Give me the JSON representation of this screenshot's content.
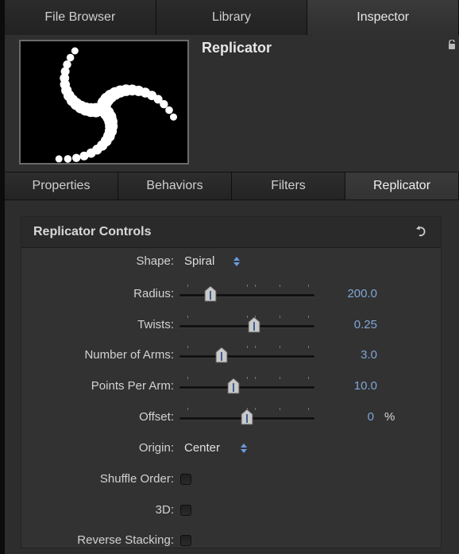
{
  "top_tabs": [
    {
      "label": "File Browser"
    },
    {
      "label": "Library"
    },
    {
      "label": "Inspector"
    }
  ],
  "header": {
    "title": "Replicator"
  },
  "sub_tabs": [
    {
      "label": "Properties"
    },
    {
      "label": "Behaviors"
    },
    {
      "label": "Filters"
    },
    {
      "label": "Replicator"
    }
  ],
  "panel": {
    "title": "Replicator Controls",
    "shape": {
      "label": "Shape:",
      "value": "Spiral"
    },
    "radius": {
      "label": "Radius:",
      "value": "200.0",
      "level": 0.23
    },
    "twists": {
      "label": "Twists:",
      "value": "0.25",
      "level": 0.55
    },
    "arms": {
      "label": "Number of Arms:",
      "value": "3.0",
      "level": 0.31
    },
    "points": {
      "label": "Points Per Arm:",
      "value": "10.0",
      "level": 0.4
    },
    "offset": {
      "label": "Offset:",
      "value": "0",
      "unit": "%",
      "level": 0.5
    },
    "origin": {
      "label": "Origin:",
      "value": "Center"
    },
    "shuffle": {
      "label": "Shuffle Order:",
      "checked": false
    },
    "three_d": {
      "label": "3D:",
      "checked": false
    },
    "reverse": {
      "label": "Reverse Stacking:",
      "checked": false
    }
  },
  "colors": {
    "accent": "#7fa6d6",
    "background": "#2d2d2d"
  }
}
